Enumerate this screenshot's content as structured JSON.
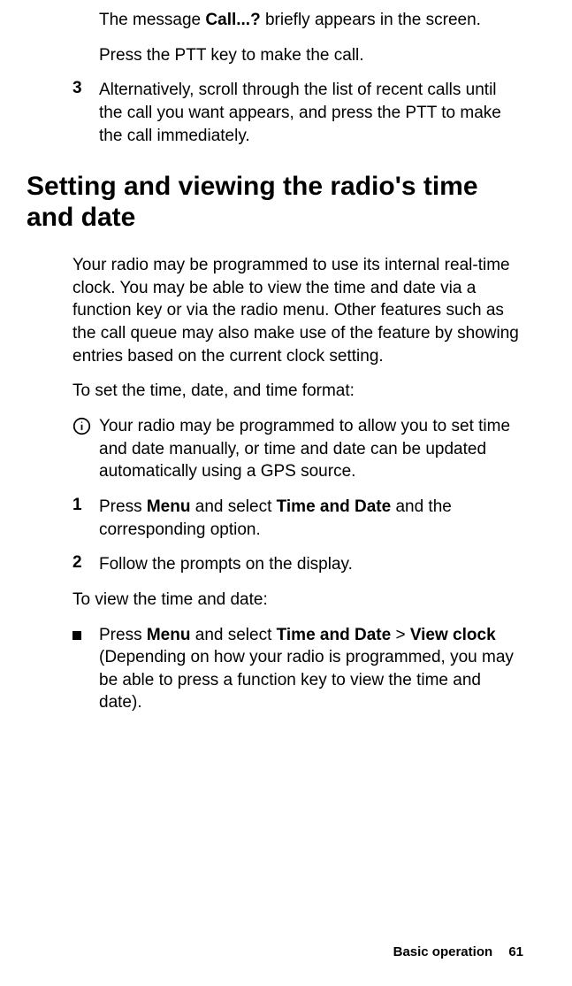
{
  "top": {
    "msg_pre": "The message ",
    "msg_bold": "Call...?",
    "msg_post": " briefly appears in the screen.",
    "press_ptt": "Press the PTT key to make the call.",
    "step3_num": "3",
    "step3_body": "Alternatively, scroll through the list of recent calls until the call you want appears, and press the PTT to make the call immediately."
  },
  "heading": "Setting and viewing the radio's time and date",
  "intro": "Your radio may be programmed to use its internal real-time clock. You may be able to view the time and date via a function key or via the radio menu. Other features such as the call queue may also make use of the feature by showing entries based on the current clock setting.",
  "to_set": "To set the time, date, and time format:",
  "info_note": "Your radio may be programmed to allow you to set time and date manually, or time and date can be updated automatically using a GPS source.",
  "step1_num": "1",
  "step1_a": "Press ",
  "step1_b": "Menu",
  "step1_c": " and select ",
  "step1_d": "Time and Date",
  "step1_e": " and the corresponding option.",
  "step2_num": "2",
  "step2_body": "Follow the prompts on the display.",
  "to_view": "To view the time and date:",
  "bullet_a": "Press ",
  "bullet_b": "Menu",
  "bullet_c": " and select ",
  "bullet_d": "Time and Date",
  "bullet_e": " > ",
  "bullet_f": "View clock",
  "bullet_g": " (Depending on how your radio is pro­grammed, you may be able to press a function key to view the time and date).",
  "footer_section": "Basic operation",
  "footer_page": "61"
}
